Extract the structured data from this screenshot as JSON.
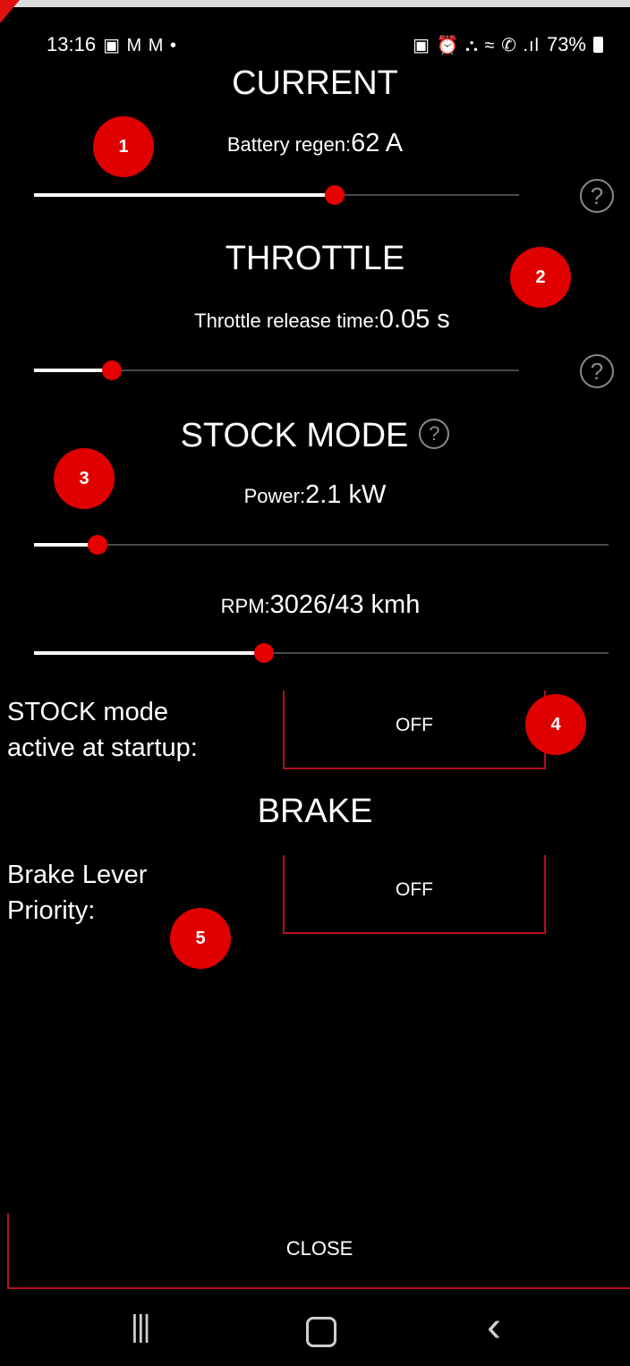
{
  "status_bar": {
    "time": "13:16",
    "left_icons": "▣ M M •",
    "right_icons": "▣ ⏰ ⛬ ≈ ✆ .ıl",
    "battery": "73%"
  },
  "current": {
    "heading": "CURRENT",
    "label": "Battery regen:",
    "value": "62 A",
    "slider_fraction": 0.62
  },
  "throttle": {
    "heading": "THROTTLE",
    "label": "Throttle release time:",
    "value": "0.05 s",
    "slider_fraction": 0.16
  },
  "stock_mode": {
    "heading": "STOCK MODE",
    "power_label": "Power:",
    "power_value": "2.1 kW",
    "power_fraction": 0.11,
    "rpm_label": "RPM:",
    "rpm_value": "3026/43 kmh",
    "rpm_fraction": 0.4,
    "startup_label_line1": "STOCK mode",
    "startup_label_line2": "active at startup:",
    "startup_toggle": "OFF"
  },
  "brake": {
    "heading": "BRAKE",
    "priority_label_line1": "Brake Lever",
    "priority_label_line2": "Priority:",
    "priority_toggle": "OFF"
  },
  "help_symbol": "?",
  "badges": [
    "1",
    "2",
    "3",
    "4",
    "5"
  ],
  "close_label": "CLOSE",
  "nav": {
    "recents": "|||",
    "back": "‹"
  },
  "colors": {
    "accent": "#e60000",
    "border_red": "#b0121b",
    "background": "#000000"
  }
}
